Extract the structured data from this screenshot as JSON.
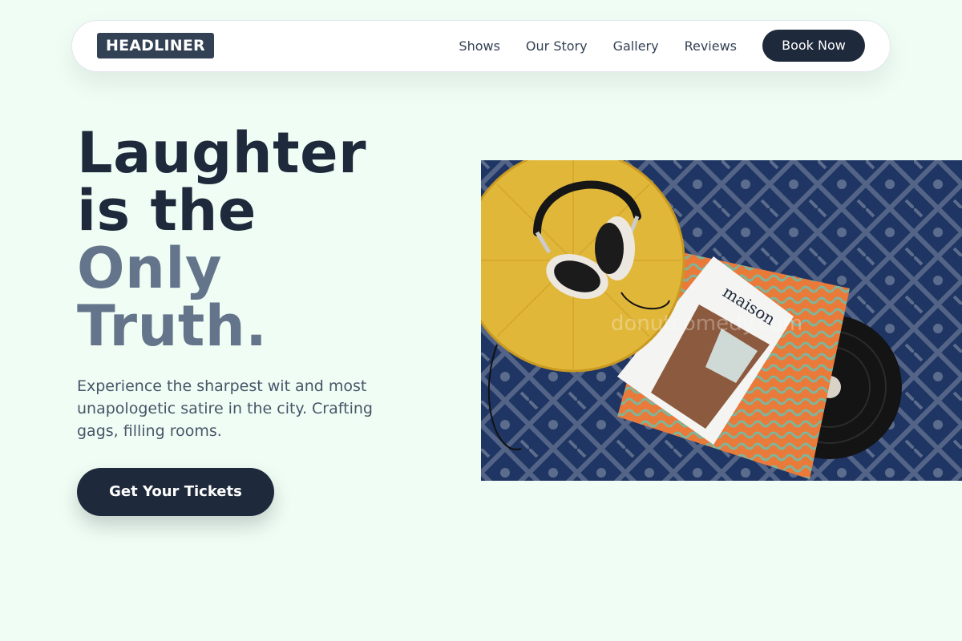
{
  "brand": {
    "logo_text": "HEADLINER"
  },
  "nav": {
    "links": [
      "Shows",
      "Our Story",
      "Gallery",
      "Reviews"
    ],
    "cta_label": "Book Now"
  },
  "hero": {
    "title_lines": [
      "Laughter",
      "is the",
      "Only",
      "Truth."
    ],
    "subtitle": "Experience the sharpest wit and most unapologetic satire in the city. Crafting gags, filling rooms.",
    "cta_label": "Get Your Tickets",
    "image": {
      "magazine_title": "maison",
      "watermark": "donutcomedy.com"
    }
  },
  "colors": {
    "background": "#f0fdf4",
    "primary": "#1e293b",
    "muted": "#64748b"
  }
}
